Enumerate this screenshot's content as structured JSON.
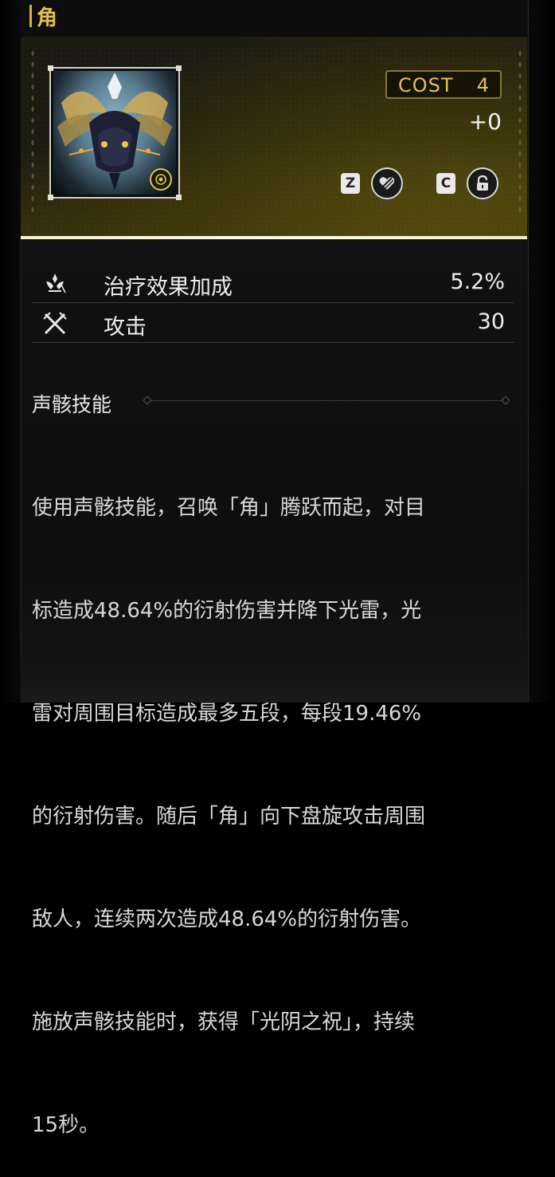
{
  "title": "角",
  "cost": {
    "label": "COST",
    "value": "4"
  },
  "level_bonus": "+0",
  "actions": {
    "lock_key": "Z",
    "unlock_key": "C"
  },
  "stats": [
    {
      "icon": "healing-bonus-icon",
      "label": "治疗效果加成",
      "value": "5.2%"
    },
    {
      "icon": "attack-icon",
      "label": "攻击",
      "value": "30"
    }
  ],
  "skill": {
    "heading": "声骸技能",
    "lines": [
      "使用声骸技能，召唤「角」腾跃而起，对目",
      "标造成48.64%的衍射伤害并降下光雷，光",
      "雷对周围目标造成最多五段，每段19.46%",
      "的衍射伤害。随后「角」向下盘旋攻击周围",
      "敌人，连续两次造成48.64%的衍射伤害。",
      "施放声骸技能时，获得「光阴之祝」，持续",
      "15秒。"
    ]
  },
  "colors": {
    "accent_gold": "#e6c24a",
    "panel_bg": "#111111",
    "text": "#e8e8e8"
  }
}
